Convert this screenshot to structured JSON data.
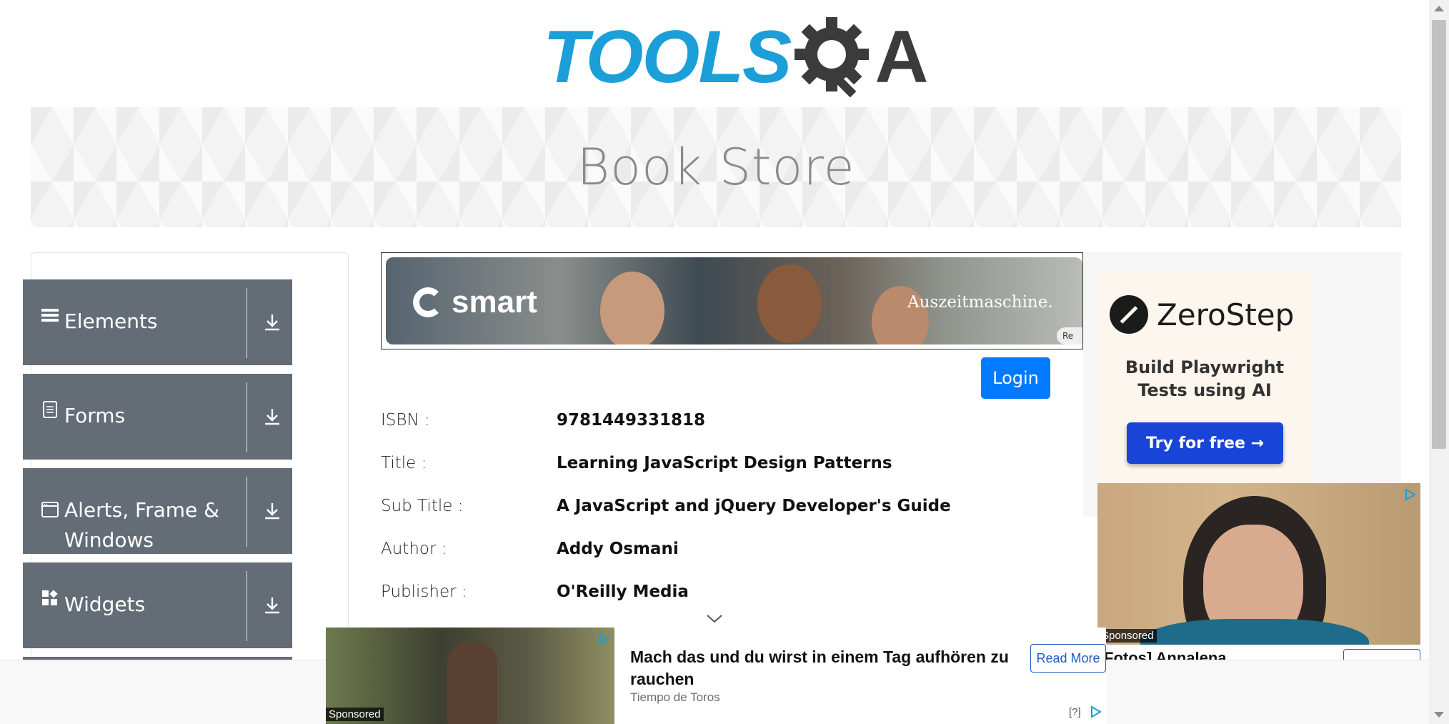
{
  "header": {
    "logo_text": "TOOLS",
    "logo_qa": "A"
  },
  "banner": {
    "title": "Book Store"
  },
  "sidebar": {
    "groups": [
      {
        "label": "Elements",
        "icon": "hamburger-icon"
      },
      {
        "label": "Forms",
        "icon": "document-icon"
      },
      {
        "label": "Alerts, Frame & Windows",
        "icon": "window-icon"
      },
      {
        "label": "Widgets",
        "icon": "widgets-icon"
      }
    ]
  },
  "top_ad": {
    "brand": "smart",
    "tagline": "Auszeitmaschine.",
    "info": "Re"
  },
  "login": {
    "label": "Login"
  },
  "book": {
    "fields": [
      {
        "label": "ISBN :",
        "value": "9781449331818"
      },
      {
        "label": "Title :",
        "value": "Learning JavaScript Design Patterns"
      },
      {
        "label": "Sub Title :",
        "value": "A JavaScript and jQuery Developer's Guide"
      },
      {
        "label": "Author :",
        "value": "Addy Osmani"
      },
      {
        "label": "Publisher :",
        "value": "O'Reilly Media"
      }
    ]
  },
  "right_ad": {
    "brand": "ZeroStep",
    "headline": "Build Playwright Tests using AI",
    "cta": "Try for free →",
    "sponsored": "Sponsored",
    "caption": "Fotos] Annalena"
  },
  "bottom_ad": {
    "headline": "Mach das und du wirst in einem Tag aufhören zu rauchen",
    "source": "Tiempo de Toros",
    "cta": "Read More",
    "sponsored": "Sponsored",
    "help": "[?]"
  },
  "colors": {
    "accent": "#007bff",
    "sidebar_group": "#646c76",
    "logo_blue": "#1c9fd8"
  }
}
